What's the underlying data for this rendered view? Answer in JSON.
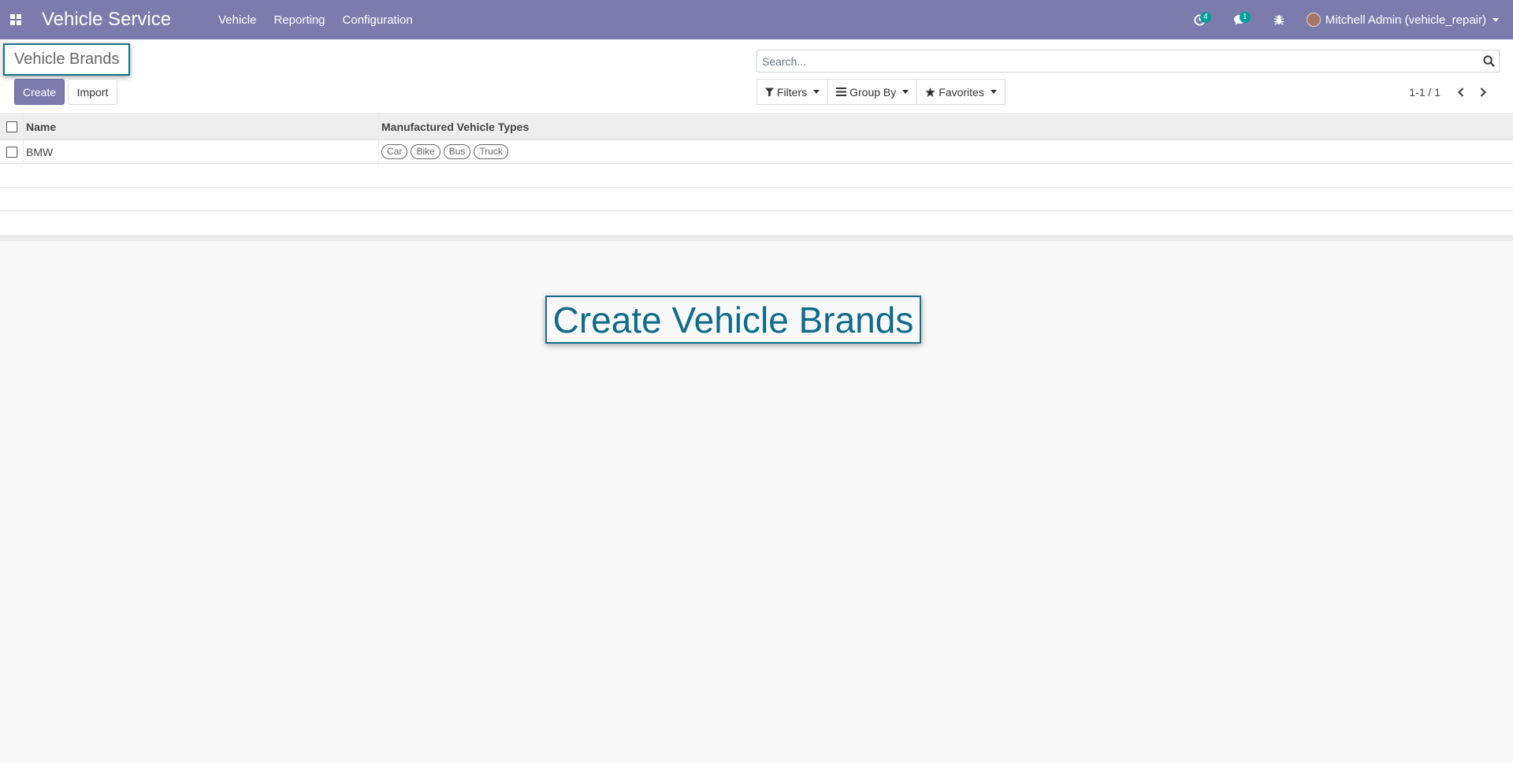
{
  "navbar": {
    "brand": "Vehicle Service",
    "menu": [
      "Vehicle",
      "Reporting",
      "Configuration"
    ],
    "activity_count": "4",
    "message_count": "1",
    "user_name": "Mitchell Admin (vehicle_repair)",
    "bg_color": "#7c7bad",
    "badge_color": "#00a09d"
  },
  "control_panel": {
    "breadcrumb": "Vehicle Brands",
    "create_label": "Create",
    "import_label": "Import",
    "search_placeholder": "Search...",
    "filters_label": "Filters",
    "group_by_label": "Group By",
    "favorites_label": "Favorites",
    "pager_value": "1-1 / 1"
  },
  "table": {
    "columns": [
      "Name",
      "Manufactured Vehicle Types"
    ],
    "rows": [
      {
        "name": "BMW",
        "types": [
          "Car",
          "Bike",
          "Bus",
          "Truck"
        ]
      }
    ]
  },
  "callout": {
    "text": "Create Vehicle Brands",
    "color": "#0e6b8a"
  },
  "icons": {
    "apps": "apps-grid-icon",
    "activity": "clock-icon",
    "messages": "chat-icon",
    "debug": "bug-icon",
    "search": "search-icon",
    "filter": "filter-icon",
    "group_by": "list-icon",
    "favorites": "star-icon",
    "prev": "chevron-left-icon",
    "next": "chevron-right-icon"
  }
}
